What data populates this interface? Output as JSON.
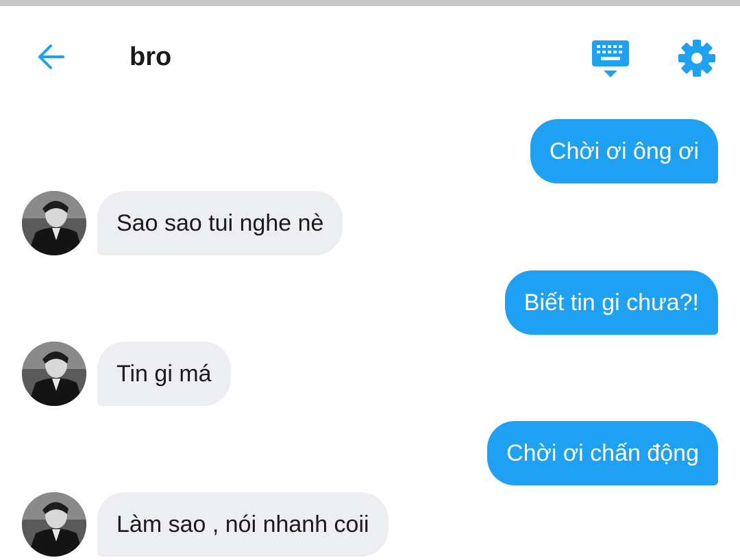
{
  "header": {
    "title": "bro",
    "back_icon": "arrow-left-icon",
    "keyboard_icon": "keyboard-icon",
    "settings_icon": "gear-icon",
    "accent_color": "#1ea1f2"
  },
  "messages": [
    {
      "direction": "out",
      "text": "Chời ơi ông ơi"
    },
    {
      "direction": "in",
      "text": "Sao sao tui nghe nè"
    },
    {
      "direction": "out",
      "text": "Biết tin gi chưa?!"
    },
    {
      "direction": "in",
      "text": "Tin gi má"
    },
    {
      "direction": "out",
      "text": "Chời ơi chấn động"
    },
    {
      "direction": "in",
      "text": "Làm sao , nói nhanh coii"
    }
  ],
  "colors": {
    "outgoing_bubble": "#1ea1f2",
    "incoming_bubble": "#eceef1",
    "top_strip": "#c8c8c8"
  }
}
